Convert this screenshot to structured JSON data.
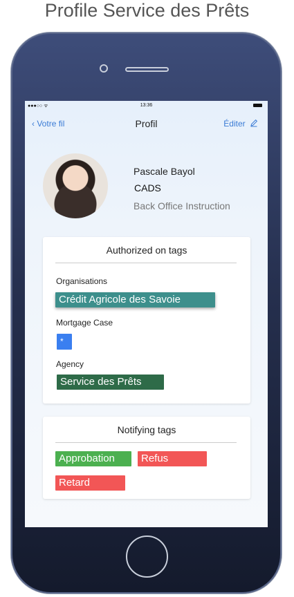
{
  "caption": "Profile Service des Prêts",
  "status_bar": {
    "signal": "●●●○○ ᯤ",
    "time": "13:36"
  },
  "nav": {
    "back_label": "Votre fil",
    "title": "Profil",
    "edit_label": "Éditer"
  },
  "profile": {
    "name": "Pascale Bayol",
    "organization": "CADS",
    "role": "Back Office Instruction"
  },
  "authorized": {
    "title": "Authorized on tags",
    "organisations_label": "Organisations",
    "organisations_tag": "Crédit Agricole des Savoie",
    "mortgage_label": "Mortgage Case",
    "mortgage_tag": "*",
    "agency_label": "Agency",
    "agency_tag": "Service des Prêts"
  },
  "notifying": {
    "title": "Notifying tags",
    "tags": [
      "Approbation",
      "Refus",
      "Retard"
    ]
  },
  "colors": {
    "accent": "#3a7bd5",
    "tag_teal": "#3d8f8c",
    "tag_blue": "#3a7ff0",
    "tag_dark_green": "#2e6b48",
    "tag_green": "#4cb050",
    "tag_red": "#f25656"
  }
}
